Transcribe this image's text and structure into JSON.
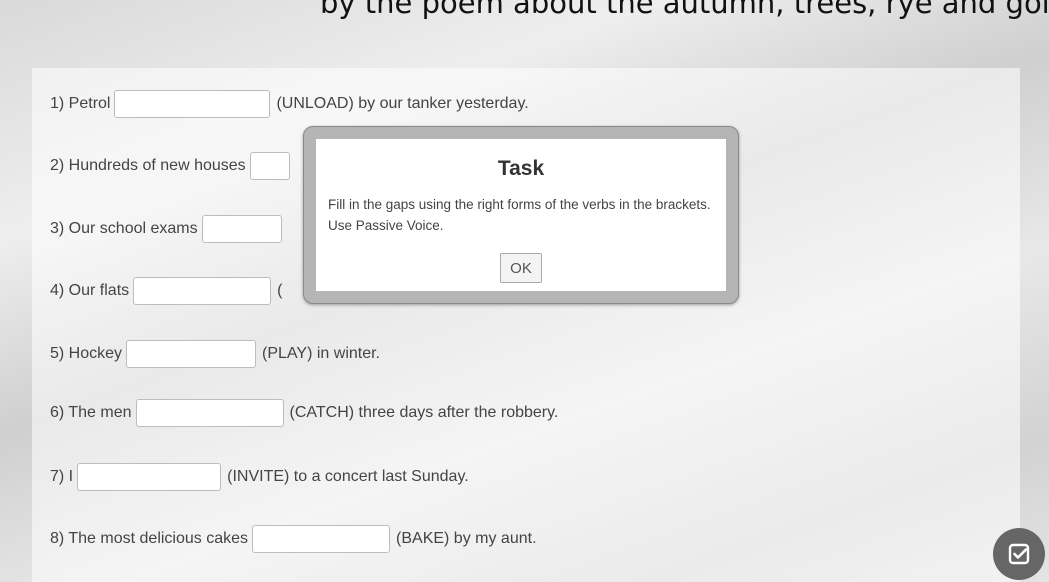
{
  "caption": {
    "text": "by the poem about the autumn, trees, rye and going ou"
  },
  "items": [
    {
      "prefix": "1) Petrol",
      "value": "",
      "suffix": "(UNLOAD) by our tanker yesterday."
    },
    {
      "prefix": "2) Hundreds of new houses",
      "value": "",
      "suffix": ""
    },
    {
      "prefix": "3) Our school exams",
      "value": "",
      "suffix": ""
    },
    {
      "prefix": "4) Our flats",
      "value": "",
      "suffix": "("
    },
    {
      "prefix": "5) Hockey",
      "value": "",
      "suffix": "(PLAY) in winter."
    },
    {
      "prefix": "6) The men",
      "value": "",
      "suffix": "(CATCH) three days after the robbery."
    },
    {
      "prefix": "7) I",
      "value": "",
      "suffix": "(INVITE) to a concert last Sunday."
    },
    {
      "prefix": "8) The most delicious cakes",
      "value": "",
      "suffix": "(BAKE) by my aunt."
    }
  ],
  "modal": {
    "title": "Task",
    "text": "Fill in the gaps using the right forms of the verbs in the brackets. Use Passive Voice.",
    "ok_label": "OK"
  },
  "fab": {
    "icon": "check-square-icon"
  }
}
